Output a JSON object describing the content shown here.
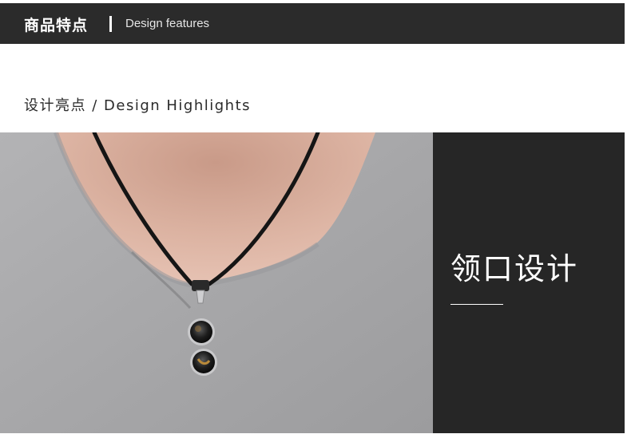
{
  "header": {
    "title_cn": "商品特点",
    "separator": "|",
    "title_en": "Design features"
  },
  "section": {
    "heading": "设计亮点 / Design Highlights"
  },
  "photo": {
    "subject": "necklace-on-grey-shirt"
  },
  "side_panel": {
    "feature_title": "领口设计"
  },
  "colors": {
    "header_bg": "#2b2b2b",
    "panel_bg": "#262626",
    "shirt": "#a9a9ab",
    "skin": "#d7ab99"
  }
}
